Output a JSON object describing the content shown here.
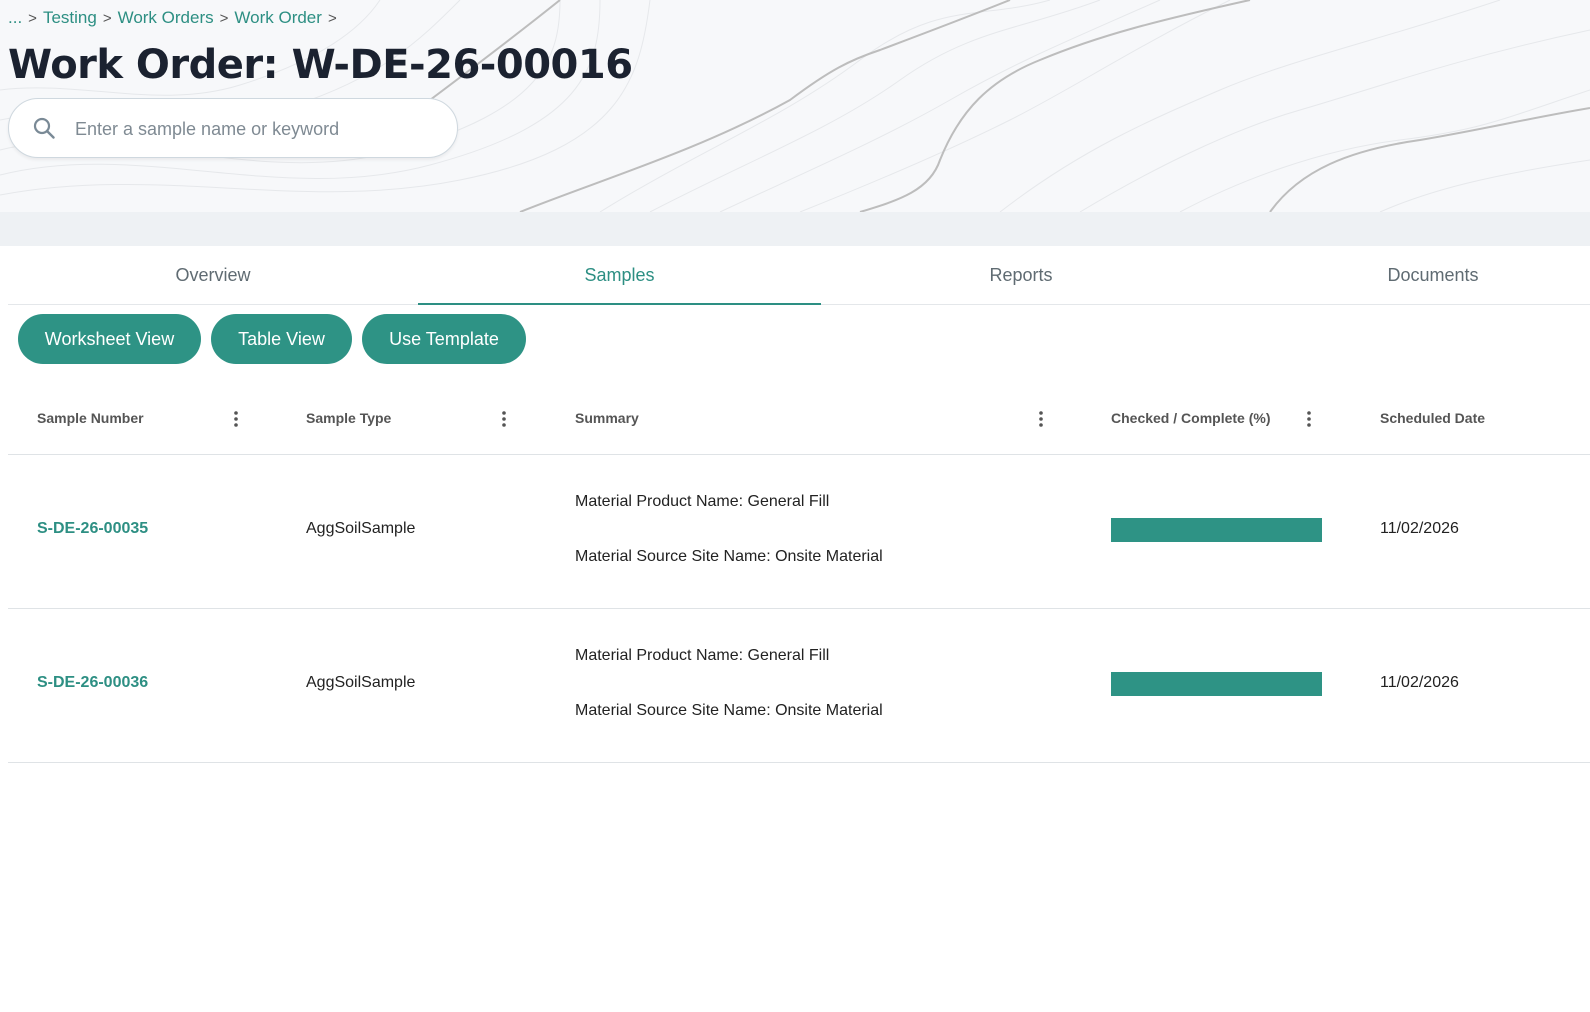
{
  "breadcrumb": {
    "items": [
      "...",
      "Testing",
      "Work Orders",
      "Work Order"
    ],
    "separator": ">"
  },
  "page": {
    "title": "Work Order: W-DE-26-00016"
  },
  "search": {
    "placeholder": "Enter a sample name or keyword",
    "value": ""
  },
  "tabs": [
    {
      "label": "Overview",
      "active": false
    },
    {
      "label": "Samples",
      "active": true
    },
    {
      "label": "Reports",
      "active": false
    },
    {
      "label": "Documents",
      "active": false
    }
  ],
  "actions": {
    "worksheet_view": "Worksheet View",
    "table_view": "Table View",
    "use_template": "Use Template"
  },
  "table": {
    "columns": [
      "Sample Number",
      "Sample Type",
      "Summary",
      "Checked / Complete (%)",
      "Scheduled Date"
    ],
    "rows": [
      {
        "sample_number": "S-DE-26-00035",
        "sample_type": "AggSoilSample",
        "summary_line1": "Material Product Name: General Fill",
        "summary_line2": "Material Source Site Name: Onsite Material",
        "progress_fraction": 1.0,
        "scheduled_date": "11/02/2026"
      },
      {
        "sample_number": "S-DE-26-00036",
        "sample_type": "AggSoilSample",
        "summary_line1": "Material Product Name: General Fill",
        "summary_line2": "Material Source Site Name: Onsite Material",
        "progress_fraction": 1.0,
        "scheduled_date": "11/02/2026"
      }
    ]
  },
  "colors": {
    "accent": "#2e9385",
    "link": "#2d8f83",
    "title": "#1b2230",
    "hero_background": "#f7f8fa"
  },
  "icons": {
    "search": "search-icon",
    "column_menu": "kebab-menu-icon"
  }
}
